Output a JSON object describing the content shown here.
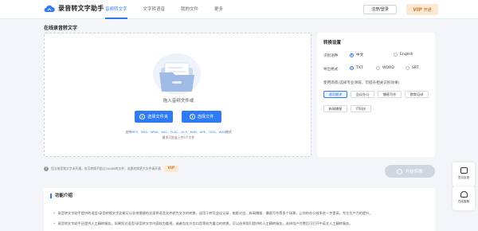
{
  "header": {
    "brand": "录音转文字助手",
    "nav": [
      "音频转文字",
      "文字转语音",
      "我的文件",
      "更多"
    ],
    "login_label": "注册/登录",
    "vip_badge": "VIP",
    "vip_label": "开通"
  },
  "section_title": "在线录音转文字",
  "upload": {
    "drag_text": "拖入音频文件或",
    "select_folder_label": "选择文件夹",
    "select_file_label": "选择文件",
    "formats_prefix": "支持",
    "formats_list": "MP3、M4A、WMA、AAC、FLAC、AC3、M4R、APE、OGG、WAV",
    "formats_suffix": "格式",
    "limit_text": "最多可批量上传9个文件"
  },
  "settings": {
    "title": "转换设置",
    "language_label": "识别语种",
    "language_options": [
      "中文",
      "English"
    ],
    "language_selected": "中文",
    "export_label": "导出格式",
    "export_options": [
      "TXT",
      "WORD",
      "SRT"
    ],
    "export_selected": "TXT",
    "scene_label": "使用场景(选择专业领域，可提升相关识别效果)",
    "scenes": [
      "通用翻译",
      "会议办公",
      "播感写作",
      "新闻播报",
      "IT科技",
      "教育培训"
    ],
    "scene_selected": "通用翻译"
  },
  "notice": {
    "text": "您当前音频文字未开通，仅可转换不超过200KB的文件，若要转换更大文件请开通",
    "vip_badge": "VIP"
  },
  "start_label": "开始转换",
  "side": {
    "feedback_label": "意见反馈",
    "service_label": "在线客服"
  },
  "intro": {
    "title": "功能介绍",
    "lines": [
      "录音转文字助手提供的语音/录音转换文字功能可以非常便捷的实现将语音文件转为文字的转换，适用于转写会议记录、电影对白、新闻播报、播感写作等多个场景，让你的办公效率进一步提高，专注生产力的提升。",
      "录音转文字助手还提供人工精转服务，如果您对语音/录音转文字内容较为重视，或者包含方言口音等较为重点的转换，可以选择我们提供的人工精转服务，选择用户付费后可打开中英文人工精转服务。"
    ]
  },
  "colors": {
    "accent": "#2f7bf6",
    "vip_bg": "#fde9d3",
    "vip_text": "#c97a2c",
    "page_bg": "#f3f5f9"
  },
  "icons": [
    "cloud-logo-icon",
    "folder-illustration-icon",
    "folder-icon",
    "file-icon",
    "info-icon",
    "convert-icon",
    "feedback-icon",
    "headset-icon"
  ]
}
